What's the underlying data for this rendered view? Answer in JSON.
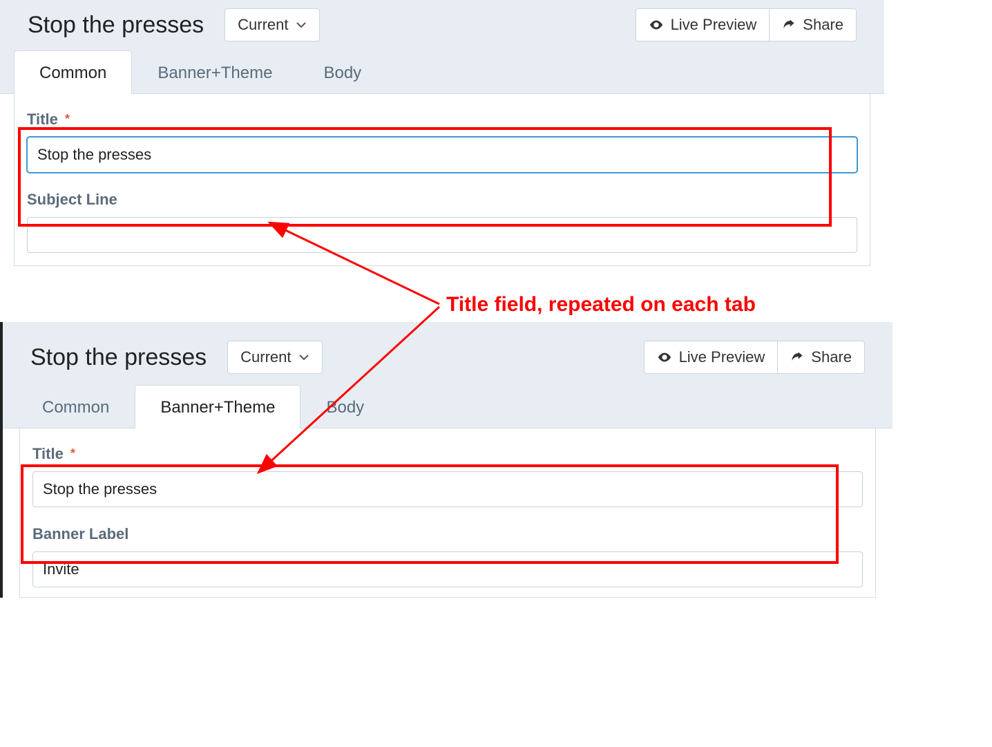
{
  "header": {
    "page_title": "Stop the presses",
    "version_button": "Current",
    "live_preview": "Live Preview",
    "share": "Share"
  },
  "tabs": {
    "common": "Common",
    "banner_theme": "Banner+Theme",
    "body": "Body"
  },
  "fields": {
    "title_label": "Title",
    "title_value": "Stop the presses",
    "subject_line_label": "Subject Line",
    "subject_line_value": "",
    "banner_label_label": "Banner Label",
    "banner_label_value": "Invite"
  },
  "annotation": {
    "text": "Title field, repeated on each tab"
  }
}
